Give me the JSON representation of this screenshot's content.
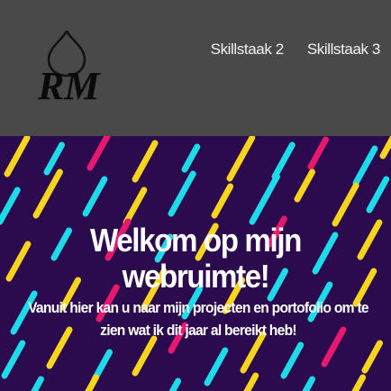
{
  "header": {
    "logo_text": "RM",
    "nav": [
      {
        "label": "Skillstaak 2"
      },
      {
        "label": "Skillstaak 3"
      }
    ]
  },
  "hero": {
    "title": "Welkom op mijn webruimte!",
    "subtitle": "Vanuit hier kan u naar mijn projecten en portofolio om te zien wat ik dit jaar al bereikt heb!",
    "stripe_colors": [
      "#f7d51c",
      "#1ddbe9",
      "#e8186e"
    ],
    "background_color": "#2b0b4d"
  }
}
